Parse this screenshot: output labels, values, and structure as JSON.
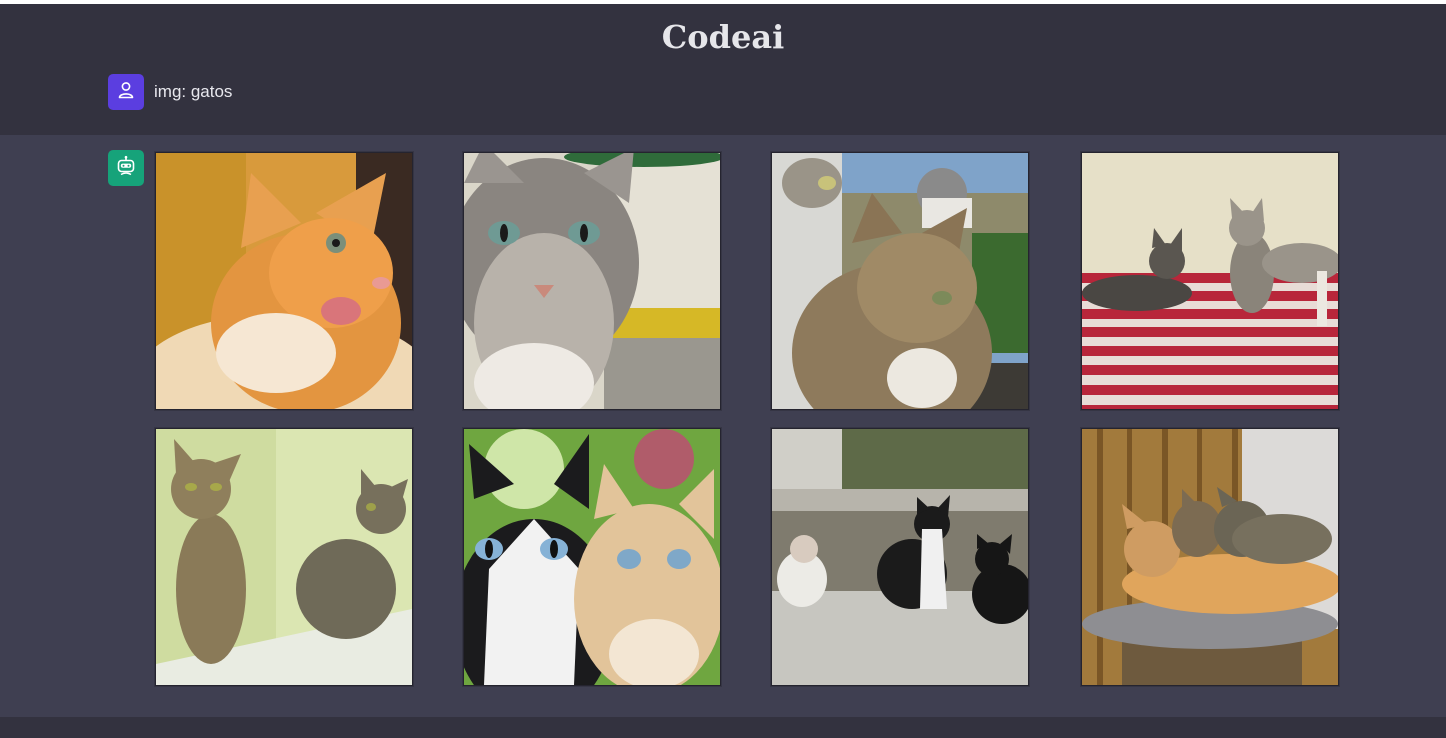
{
  "app": {
    "title": "Codeai"
  },
  "conversation": {
    "user_message": "img: gatos",
    "user_avatar_icon": "user-icon",
    "bot_avatar_icon": "robot-icon"
  },
  "colors": {
    "background": "#3f3f51",
    "header": "#33323f",
    "user_avatar": "#5b3ee0",
    "bot_avatar": "#16a37a"
  },
  "images": [
    {
      "subject": "orange kitten"
    },
    {
      "subject": "gray tabby cat close-up"
    },
    {
      "subject": "tabby cat on balcony"
    },
    {
      "subject": "two kittens on striped blanket"
    },
    {
      "subject": "two tabby kittens by wall"
    },
    {
      "subject": "black-white and cream cats"
    },
    {
      "subject": "three cats on stone steps"
    },
    {
      "subject": "three cats on cat tree"
    }
  ]
}
